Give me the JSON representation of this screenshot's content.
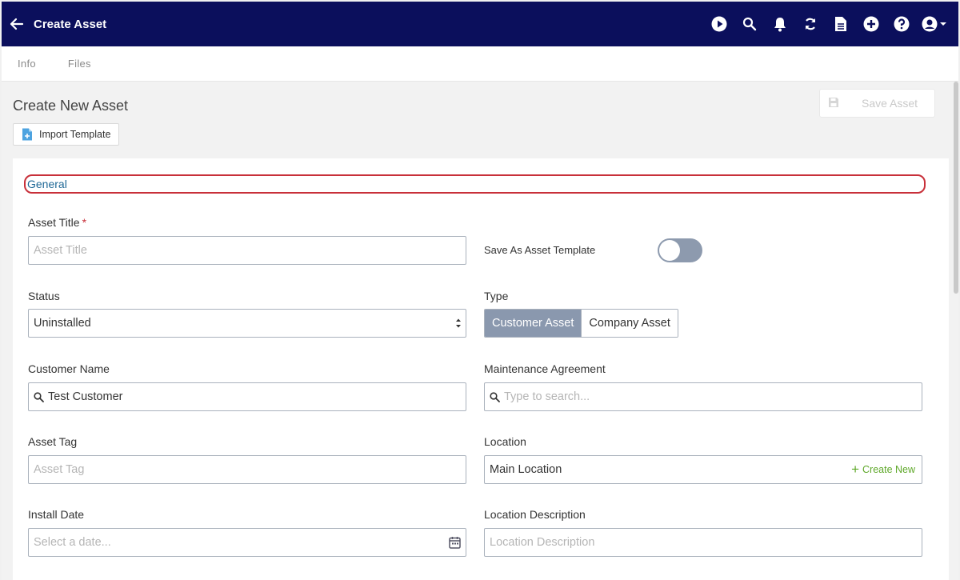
{
  "header": {
    "title": "Create Asset",
    "icons": [
      "back-arrow-icon",
      "play-icon",
      "search-icon",
      "bell-icon",
      "sync-icon",
      "document-icon",
      "add-icon",
      "help-icon",
      "user-account-icon"
    ]
  },
  "tabs": [
    {
      "label": "Info"
    },
    {
      "label": "Files"
    }
  ],
  "page": {
    "title": "Create New Asset",
    "import_template_label": "Import Template",
    "save_label": "Save Asset"
  },
  "form": {
    "section_title": "General",
    "asset_title": {
      "label": "Asset Title",
      "required_mark": "*",
      "placeholder": "Asset Title",
      "value": ""
    },
    "save_as_template": {
      "label": "Save As Asset Template",
      "enabled": false
    },
    "status": {
      "label": "Status",
      "value": "Uninstalled"
    },
    "type": {
      "label": "Type",
      "options": [
        "Customer Asset",
        "Company Asset"
      ],
      "selected": "Customer Asset"
    },
    "customer_name": {
      "label": "Customer Name",
      "value": "Test Customer"
    },
    "maintenance_agreement": {
      "label": "Maintenance Agreement",
      "placeholder": "Type to search..."
    },
    "asset_tag": {
      "label": "Asset Tag",
      "placeholder": "Asset Tag"
    },
    "location": {
      "label": "Location",
      "value": "Main Location",
      "create_new_label": "Create New"
    },
    "install_date": {
      "label": "Install Date",
      "placeholder": "Select a date..."
    },
    "location_description": {
      "label": "Location Description",
      "placeholder": "Location Description"
    }
  },
  "colors": {
    "header_bg": "#0b0f5c",
    "link_blue": "#1f6896",
    "required_red": "#c8303a",
    "segment_active": "#8a98ae",
    "create_new_green": "#5fa82a"
  }
}
